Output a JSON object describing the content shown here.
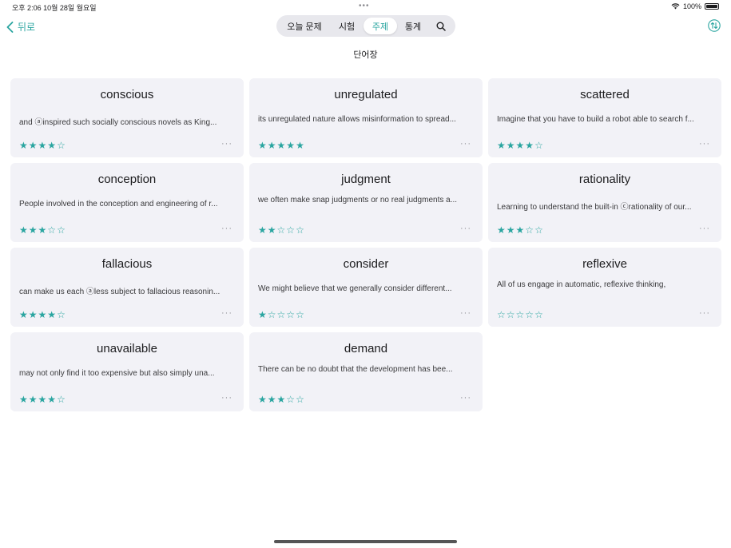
{
  "status": {
    "time": "오후 2:06   10월 28일 월요일",
    "battery": "100%",
    "dots": "•••"
  },
  "nav": {
    "back_label": "뒤로",
    "segments": [
      {
        "label": "오늘 문제",
        "active": false
      },
      {
        "label": "시험",
        "active": false
      },
      {
        "label": "주제",
        "active": true
      },
      {
        "label": "통계",
        "active": false
      }
    ]
  },
  "title": "단어장",
  "accent_color": "#2aa5a0",
  "cards": [
    {
      "word": "conscious",
      "sentence": "and ⓐinspired such socially conscious novels as King...",
      "rating": 4
    },
    {
      "word": "unregulated",
      "sentence": "its unregulated nature allows misinformation to spread...",
      "rating": 5
    },
    {
      "word": "scattered",
      "sentence": "Imagine that you have to build a robot able to search f...",
      "rating": 4
    },
    {
      "word": "conception",
      "sentence": "People involved in the conception and engineering of r...",
      "rating": 3
    },
    {
      "word": "judgment",
      "sentence": "we often make snap judgments or no real judgments a...",
      "rating": 2
    },
    {
      "word": "rationality",
      "sentence": "Learning to understand the built-in ⓒrationality of our...",
      "rating": 3
    },
    {
      "word": "fallacious",
      "sentence": "can make us each ⓐless subject to fallacious reasonin...",
      "rating": 4
    },
    {
      "word": "consider",
      "sentence": "We might believe that we generally consider different...",
      "rating": 1
    },
    {
      "word": "reflexive",
      "sentence": "All of us engage in automatic, reflexive thinking,",
      "rating": 0
    },
    {
      "word": "unavailable",
      "sentence": "may not only find it too expensive but also simply una...",
      "rating": 4
    },
    {
      "word": "demand",
      "sentence": "There can be no doubt that the development has bee...",
      "rating": 3
    }
  ],
  "more_label": "···"
}
